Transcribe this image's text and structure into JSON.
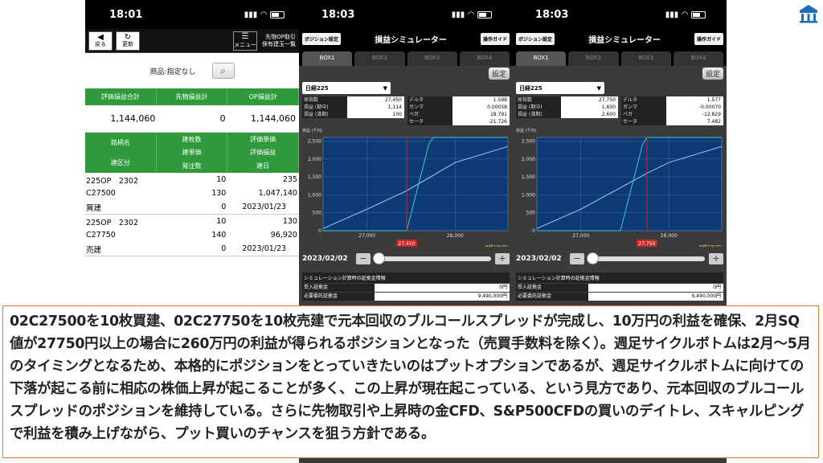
{
  "screen1": {
    "time": "18:01",
    "toolbar": {
      "back": "戻る",
      "refresh": "更新",
      "menu": "メニュー",
      "title_line1": "先物OP取引",
      "title_line2": "保有建玉一覧"
    },
    "filter_label": "商品:指定なし",
    "summary_headers": [
      "評価損益合計",
      "先物損益計",
      "OP損益計"
    ],
    "summary_values": [
      "1,144,060",
      "0",
      "1,144,060"
    ],
    "col1": [
      "銘柄名",
      "建区分"
    ],
    "col2": [
      "建枚数",
      "建単価",
      "発注数"
    ],
    "col3": [
      "評価単価",
      "評価損益",
      "建日"
    ],
    "positions": [
      {
        "name1": "225OP　2302",
        "name2": "C27500",
        "side": "買建",
        "qty": "10",
        "price": "130",
        "order": "0",
        "eval_price": "235",
        "eval_pl": "1,047,140",
        "date": "2023/01/23"
      },
      {
        "name1": "225OP　2302",
        "name2": "C27750",
        "side": "売建",
        "qty": "10",
        "price": "140",
        "order": "0",
        "eval_price": "130",
        "eval_pl": "96,920",
        "date": "2023/01/23"
      }
    ]
  },
  "sim_common": {
    "pos_btn": "ポジション設定",
    "title": "損益シミュレーター",
    "guide_btn": "操作ガイド",
    "tabs": [
      "BOX1",
      "BOX2",
      "BOX3",
      "BOX4"
    ],
    "reset": "設定",
    "select": "日経225",
    "labels": {
      "underlying": "原指数",
      "pl_mid": "損益 (期中)",
      "pl_exp": "損益 (満期)",
      "delta": "デルタ",
      "gamma": "ガンマ",
      "vega": "ベガ",
      "theta": "セータ"
    },
    "y_unit": "損益 (千円)",
    "x_unit": "日経225(円)",
    "y_ticks": [
      "2,500",
      "2,000",
      "1,500",
      "1,000",
      "500",
      "0"
    ],
    "x_ticks": [
      "27,000",
      "28,000"
    ],
    "date": "2023/02/02",
    "minus": "−",
    "plus": "+",
    "margin_title": "シミュレーション計算時の証拠金情報",
    "margin_labels": [
      "受入証拠金",
      "必要委託証拠金"
    ],
    "margin_values": [
      "0円",
      "9,490,000円"
    ]
  },
  "screen2": {
    "time": "18:03",
    "underlying": "27,450",
    "pl_mid": "1,114",
    "pl_exp": "100",
    "delta": "1.598",
    "gamma": "0.00058",
    "vega": "18.791",
    "theta": "-21.726",
    "marker": "27,450",
    "chart_data": {
      "type": "line",
      "x_range": [
        26500,
        28600
      ],
      "y_range": [
        0,
        2600
      ],
      "expiry": {
        "x": [
          26500,
          27450,
          27700,
          27750,
          28600
        ],
        "y": [
          0,
          0,
          2400,
          2600,
          2600
        ]
      },
      "mid_pl": {
        "x": [
          26500,
          27000,
          27450,
          28000,
          28600
        ],
        "y": [
          60,
          600,
          1114,
          1900,
          2350
        ]
      }
    }
  },
  "screen3": {
    "time": "18:03",
    "underlying": "27,750",
    "pl_mid": "1,600",
    "pl_exp": "2,600",
    "delta": "1.577",
    "gamma": "-0.00070",
    "vega": "-12.829",
    "theta": "7.482",
    "marker": "27,750",
    "chart_data": {
      "type": "line",
      "x_range": [
        26500,
        28600
      ],
      "y_range": [
        0,
        2600
      ],
      "expiry": {
        "x": [
          26500,
          27450,
          27700,
          27750,
          28600
        ],
        "y": [
          0,
          0,
          2400,
          2600,
          2600
        ]
      },
      "mid_pl": {
        "x": [
          26500,
          27000,
          27750,
          28000,
          28600
        ],
        "y": [
          60,
          600,
          1600,
          1900,
          2350
        ]
      }
    }
  },
  "note": "02C27500を10枚買建、02C27750を10枚売建で元本回収のブルコールスプレッドが完成し、10万円の利益を確保、2月SQ値が27750円以上の場合に260万円の利益が得られるポジションとなった（売買手数料を除く）。週足サイクルボトムは2月〜5月のタイミングとなるため、本格的にポジションをとっていきたいのはプットオプションであるが、週足サイクルボトムに向けての下落が起こる前に相応の株価上昇が起こることが多く、この上昇が現在起こっている、という見方であり、元本回収のブルコールスプレッドのポジションを維持している。さらに先物取引や上昇時の金CFD、S&P500CFDの買いのデイトレ、スキャルピングで利益を積み上げながら、プット買いのチャンスを狙う方針である。",
  "colors": {
    "accent_green": "#2e9a3c",
    "note_border": "#e07a3a",
    "marker_red": "#c62828",
    "chart_bg": "#0d3a75"
  }
}
